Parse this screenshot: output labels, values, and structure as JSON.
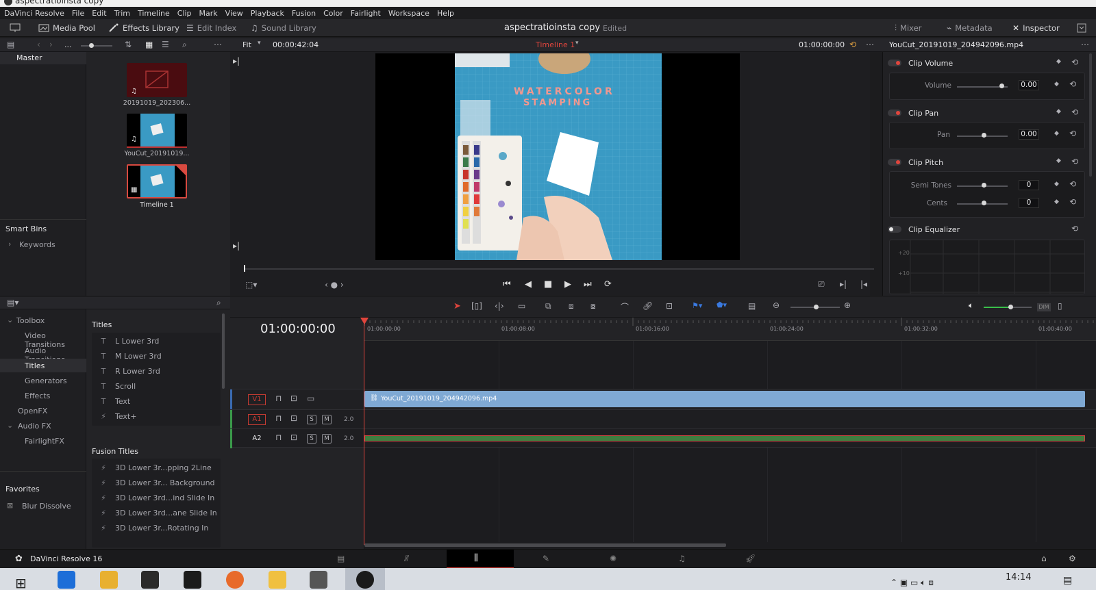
{
  "window": {
    "title": "aspectratioinsta copy"
  },
  "menu": [
    "DaVinci Resolve",
    "File",
    "Edit",
    "Trim",
    "Timeline",
    "Clip",
    "Mark",
    "View",
    "Playback",
    "Fusion",
    "Color",
    "Fairlight",
    "Workspace",
    "Help"
  ],
  "toolbar": {
    "media_pool": "Media Pool",
    "effects_library": "Effects Library",
    "edit_index": "Edit Index",
    "sound_library": "Sound Library",
    "project_title": "aspectratioinsta copy",
    "project_status": "Edited",
    "mixer": "Mixer",
    "metadata": "Metadata",
    "inspector": "Inspector"
  },
  "media_pool": {
    "ellipsis": "...",
    "bins_header": "Master",
    "smart_bins": "Smart Bins",
    "keywords": "Keywords",
    "clips": [
      {
        "name": "20191019_202306..."
      },
      {
        "name": "YouCut_20191019..."
      },
      {
        "name": "Timeline 1"
      }
    ]
  },
  "viewer": {
    "zoom": "Fit",
    "source_timecode": "00:00:42:04",
    "timeline_name": "Timeline 1",
    "record_timecode": "01:00:00:00",
    "overlay_text_1": "WATERCOLOR",
    "overlay_text_2": "STAMPING"
  },
  "inspector": {
    "clip_name": "YouCut_20191019_204942096.mp4",
    "sections": {
      "clip_volume": "Clip Volume",
      "volume_label": "Volume",
      "volume_value": "0.00",
      "clip_pan": "Clip Pan",
      "pan_label": "Pan",
      "pan_value": "0.00",
      "clip_pitch": "Clip Pitch",
      "semitones_label": "Semi Tones",
      "semitones_value": "0",
      "cents_label": "Cents",
      "cents_value": "0",
      "clip_equalizer": "Clip Equalizer",
      "eq_plus20": "+20",
      "eq_plus10": "+10"
    }
  },
  "effects_library": {
    "tree": {
      "toolbox": "Toolbox",
      "video_transitions": "Video Transitions",
      "audio_transitions": "Audio Transitions",
      "titles": "Titles",
      "generators": "Generators",
      "effects": "Effects",
      "openfx": "OpenFX",
      "audio_fx": "Audio FX",
      "fairlightfx": "FairlightFX",
      "favorites": "Favorites",
      "blur_dissolve": "Blur Dissolve"
    },
    "titles_header": "Titles",
    "titles": [
      "L Lower 3rd",
      "M Lower 3rd",
      "R Lower 3rd",
      "Scroll",
      "Text",
      "Text+"
    ],
    "fusion_titles_header": "Fusion Titles",
    "fusion_titles": [
      "3D Lower 3r...pping 2Line",
      "3D Lower 3r... Background",
      "3D Lower 3rd...ind Slide In",
      "3D Lower 3rd...ane Slide In",
      "3D Lower 3r...Rotating In"
    ]
  },
  "timeline": {
    "timecode": "01:00:00:00",
    "ruler": [
      "01:00:00:00",
      "01:00:08:00",
      "01:00:16:00",
      "01:00:24:00",
      "01:00:32:00",
      "01:00:40:00"
    ],
    "tracks": {
      "v1": "V1",
      "a1": "A1",
      "a2": "A2",
      "solo": "S",
      "mute": "M",
      "a1_ch": "2.0",
      "a2_ch": "2.0",
      "video_clip": "YouCut_20191019_204942096.mp4"
    },
    "dim": "DIM"
  },
  "footer": {
    "app_name": "DaVinci Resolve 16"
  },
  "taskbar": {
    "time": "14:14"
  }
}
